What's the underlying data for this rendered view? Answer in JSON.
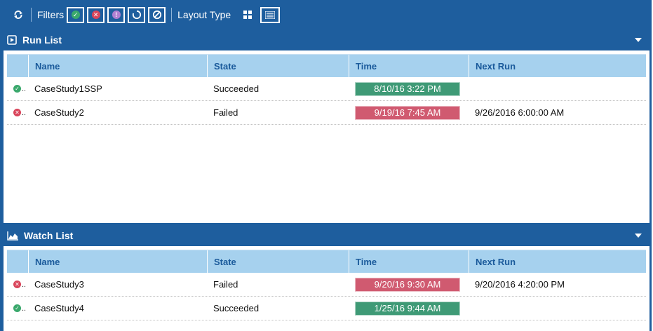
{
  "toolbar": {
    "filters_label": "Filters",
    "layout_label": "Layout Type",
    "filters": [
      {
        "icon": "check-icon",
        "glyph": "✓",
        "color": "#3aa86c"
      },
      {
        "icon": "x-icon",
        "glyph": "✕",
        "color": "#d9455b"
      },
      {
        "icon": "exclamation-icon",
        "glyph": "!",
        "color": "#b07fd1"
      },
      {
        "icon": "running-icon",
        "glyph": "",
        "color": "#ffffff"
      },
      {
        "icon": "cancel-icon",
        "glyph": "",
        "color": "#ffffff"
      }
    ]
  },
  "columns": {
    "name": "Name",
    "state": "State",
    "time": "Time",
    "next_run": "Next Run"
  },
  "run_list": {
    "title": "Run List",
    "rows": [
      {
        "status": "success",
        "ellipsis": "..",
        "name": "CaseStudy1SSP",
        "state": "Succeeded",
        "time": "8/10/16 3:22 PM",
        "time_color": "#3f9a76",
        "next_run": ""
      },
      {
        "status": "failed",
        "ellipsis": "..",
        "name": "CaseStudy2",
        "state": "Failed",
        "time": "9/19/16 7:45 AM",
        "time_color": "#d05a70",
        "next_run": "9/26/2016 6:00:00 AM"
      }
    ]
  },
  "watch_list": {
    "title": "Watch List",
    "rows": [
      {
        "status": "failed",
        "ellipsis": "..",
        "name": "CaseStudy3",
        "state": "Failed",
        "time": "9/20/16 9:30 AM",
        "time_color": "#d05a70",
        "next_run": "9/20/2016 4:20:00 PM"
      },
      {
        "status": "success",
        "ellipsis": "..",
        "name": "CaseStudy4",
        "state": "Succeeded",
        "time": "1/25/16 9:44 AM",
        "time_color": "#3f9a76",
        "next_run": ""
      }
    ]
  },
  "colors": {
    "frame": "#1e5e9e",
    "grid_header": "#a6d1ee",
    "header_text": "#1a5a9b",
    "success": "#3aa86c",
    "failed": "#d9455b"
  }
}
